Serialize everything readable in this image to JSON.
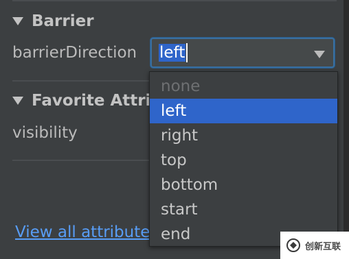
{
  "barrier_section": {
    "title": "Barrier",
    "attr_label": "barrierDirection",
    "selected_value": "left"
  },
  "favorite_section": {
    "title": "Favorite Attributes",
    "attr_label": "visibility"
  },
  "dropdown": {
    "options": [
      "none",
      "left",
      "right",
      "top",
      "bottom",
      "start",
      "end"
    ],
    "selected": "left"
  },
  "footer": {
    "link": "View all attributes"
  },
  "watermark": {
    "text": "创新互联"
  },
  "colors": {
    "background": "#3c3f41",
    "accent": "#2f65ca",
    "link": "#589df6",
    "focus_border": "#3a6f9f"
  }
}
